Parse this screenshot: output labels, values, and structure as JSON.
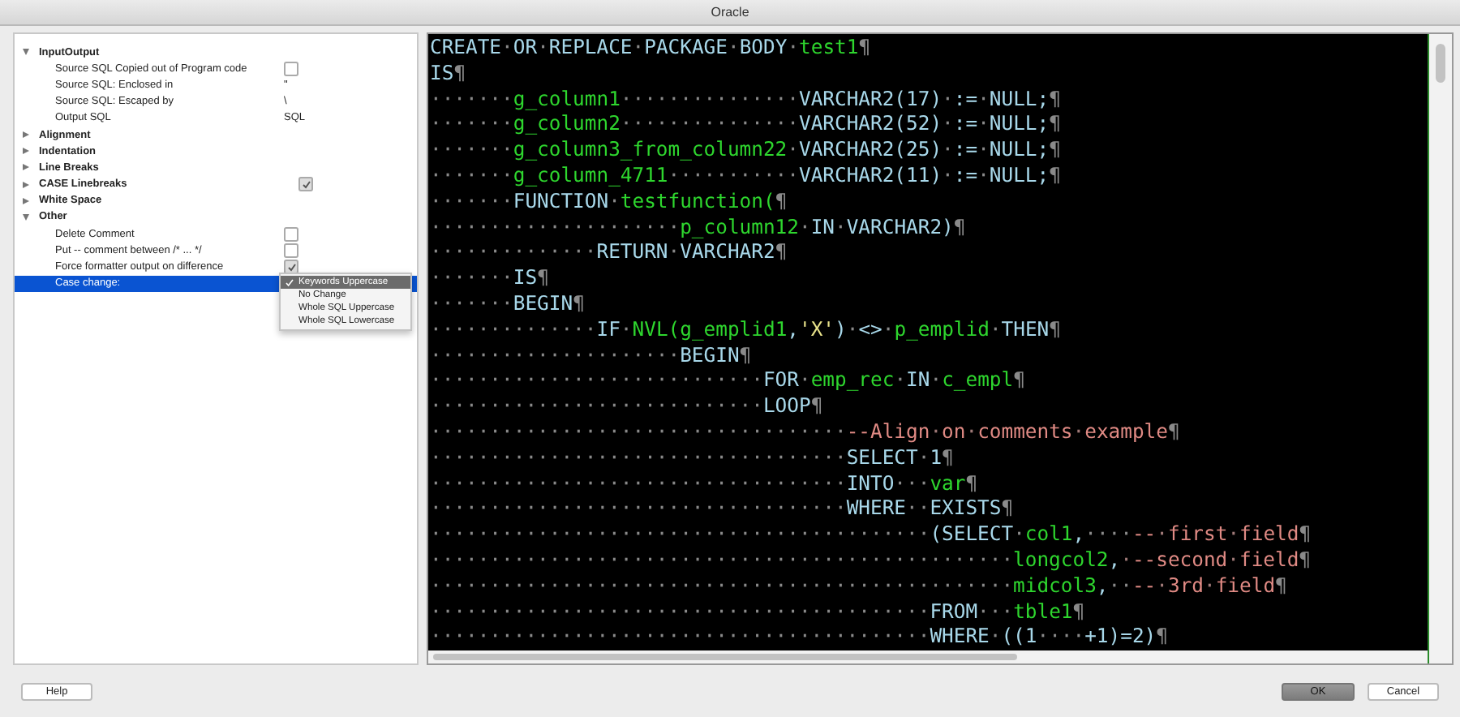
{
  "window": {
    "title": "Oracle"
  },
  "tree": [
    {
      "label": "InputOutput",
      "expanded": true,
      "children": [
        {
          "label": "Source SQL Copied out of Program code",
          "kind": "checkbox",
          "checked": false
        },
        {
          "label": "Source SQL: Enclosed in",
          "kind": "text",
          "value": "\""
        },
        {
          "label": "Source SQL: Escaped by",
          "kind": "text",
          "value": "\\"
        },
        {
          "label": "Output SQL",
          "kind": "text",
          "value": "SQL"
        }
      ]
    },
    {
      "label": "Alignment",
      "expanded": false
    },
    {
      "label": "Indentation",
      "expanded": false
    },
    {
      "label": "Line Breaks",
      "expanded": false
    },
    {
      "label": "CASE Linebreaks",
      "expanded": false,
      "kind": "checkbox",
      "checked": true
    },
    {
      "label": "White Space",
      "expanded": false
    },
    {
      "label": "Other",
      "expanded": true,
      "children": [
        {
          "label": "Delete Comment",
          "kind": "checkbox",
          "checked": false
        },
        {
          "label": "Put -- comment between /* ... */",
          "kind": "checkbox",
          "checked": false
        },
        {
          "label": "Force formatter output on difference",
          "kind": "checkbox",
          "checked": true
        },
        {
          "label": "Case change:",
          "kind": "select",
          "selected": true,
          "options": [
            {
              "label": "Keywords Uppercase",
              "selected": true
            },
            {
              "label": "No Change",
              "selected": false
            },
            {
              "label": "Whole SQL Uppercase",
              "selected": false
            },
            {
              "label": "Whole SQL Lowercase",
              "selected": false
            }
          ]
        }
      ]
    }
  ],
  "editor": {
    "lines": [
      [
        {
          "kind": "keyword",
          "text": "CREATE·OR·REPLACE·PACKAGE·BODY·"
        },
        {
          "kind": "identifier",
          "text": "test1"
        },
        {
          "kind": "keyword",
          "text": "¶"
        }
      ],
      [
        {
          "kind": "keyword",
          "text": "IS¶"
        }
      ],
      [
        {
          "kind": "keyword",
          "text": "·······"
        },
        {
          "kind": "identifier",
          "text": "g_column1"
        },
        {
          "kind": "keyword",
          "text": "···············VARCHAR2(17)·:=·NULL;¶"
        }
      ],
      [
        {
          "kind": "keyword",
          "text": "·······"
        },
        {
          "kind": "identifier",
          "text": "g_column2"
        },
        {
          "kind": "keyword",
          "text": "···············VARCHAR2(52)·:=·NULL;¶"
        }
      ],
      [
        {
          "kind": "keyword",
          "text": "·······"
        },
        {
          "kind": "identifier",
          "text": "g_column3_from_column22"
        },
        {
          "kind": "keyword",
          "text": "·VARCHAR2(25)·:=·NULL;¶"
        }
      ],
      [
        {
          "kind": "keyword",
          "text": "·······"
        },
        {
          "kind": "identifier",
          "text": "g_column_4711"
        },
        {
          "kind": "keyword",
          "text": "···········VARCHAR2(11)·:=·NULL;¶"
        }
      ],
      [
        {
          "kind": "keyword",
          "text": "·······FUNCTION·"
        },
        {
          "kind": "identifier",
          "text": "testfunction("
        },
        {
          "kind": "keyword",
          "text": "¶"
        }
      ],
      [
        {
          "kind": "keyword",
          "text": "·····················"
        },
        {
          "kind": "identifier",
          "text": "p_column12"
        },
        {
          "kind": "keyword",
          "text": "·IN·VARCHAR2)¶"
        }
      ],
      [
        {
          "kind": "keyword",
          "text": "··············RETURN·VARCHAR2¶"
        }
      ],
      [
        {
          "kind": "keyword",
          "text": "·······IS¶"
        }
      ],
      [
        {
          "kind": "keyword",
          "text": "·······BEGIN¶"
        }
      ],
      [
        {
          "kind": "keyword",
          "text": "··············IF·"
        },
        {
          "kind": "identifier",
          "text": "NVL(g_emplid1"
        },
        {
          "kind": "keyword",
          "text": ","
        },
        {
          "kind": "string",
          "text": "'X'"
        },
        {
          "kind": "keyword",
          "text": ")·<>·"
        },
        {
          "kind": "identifier",
          "text": "p_emplid"
        },
        {
          "kind": "keyword",
          "text": "·THEN¶"
        }
      ],
      [
        {
          "kind": "keyword",
          "text": "·····················BEGIN¶"
        }
      ],
      [
        {
          "kind": "keyword",
          "text": "····························FOR·"
        },
        {
          "kind": "identifier",
          "text": "emp_rec"
        },
        {
          "kind": "keyword",
          "text": "·IN·"
        },
        {
          "kind": "identifier",
          "text": "c_empl"
        },
        {
          "kind": "keyword",
          "text": "¶"
        }
      ],
      [
        {
          "kind": "keyword",
          "text": "····························LOOP¶"
        }
      ],
      [
        {
          "kind": "keyword",
          "text": "···································"
        },
        {
          "kind": "comment",
          "text": "--Align·on·comments·example"
        },
        {
          "kind": "keyword",
          "text": "¶"
        }
      ],
      [
        {
          "kind": "keyword",
          "text": "···································SELECT·1¶"
        }
      ],
      [
        {
          "kind": "keyword",
          "text": "···································INTO···"
        },
        {
          "kind": "identifier",
          "text": "var"
        },
        {
          "kind": "keyword",
          "text": "¶"
        }
      ],
      [
        {
          "kind": "keyword",
          "text": "···································WHERE··EXISTS¶"
        }
      ],
      [
        {
          "kind": "keyword",
          "text": "··········································(SELECT·"
        },
        {
          "kind": "identifier",
          "text": "col1"
        },
        {
          "kind": "keyword",
          "text": ",····"
        },
        {
          "kind": "comment",
          "text": "--·first·field"
        },
        {
          "kind": "keyword",
          "text": "¶"
        }
      ],
      [
        {
          "kind": "keyword",
          "text": "·················································"
        },
        {
          "kind": "identifier",
          "text": "longcol2"
        },
        {
          "kind": "keyword",
          "text": ","
        },
        {
          "kind": "comment",
          "text": "·--second·field"
        },
        {
          "kind": "keyword",
          "text": "¶"
        }
      ],
      [
        {
          "kind": "keyword",
          "text": "·················································"
        },
        {
          "kind": "identifier",
          "text": "midcol3"
        },
        {
          "kind": "keyword",
          "text": ",··"
        },
        {
          "kind": "comment",
          "text": "--·3rd·field"
        },
        {
          "kind": "keyword",
          "text": "¶"
        }
      ],
      [
        {
          "kind": "keyword",
          "text": "··········································FROM···"
        },
        {
          "kind": "identifier",
          "text": "tble1"
        },
        {
          "kind": "keyword",
          "text": "¶"
        }
      ],
      [
        {
          "kind": "keyword",
          "text": "··········································WHERE·((1····+1)=2)¶"
        }
      ]
    ]
  },
  "buttons": [
    {
      "label": "Help",
      "default": false
    },
    {
      "label": "OK",
      "default": true
    },
    {
      "label": "Cancel",
      "default": false
    }
  ]
}
